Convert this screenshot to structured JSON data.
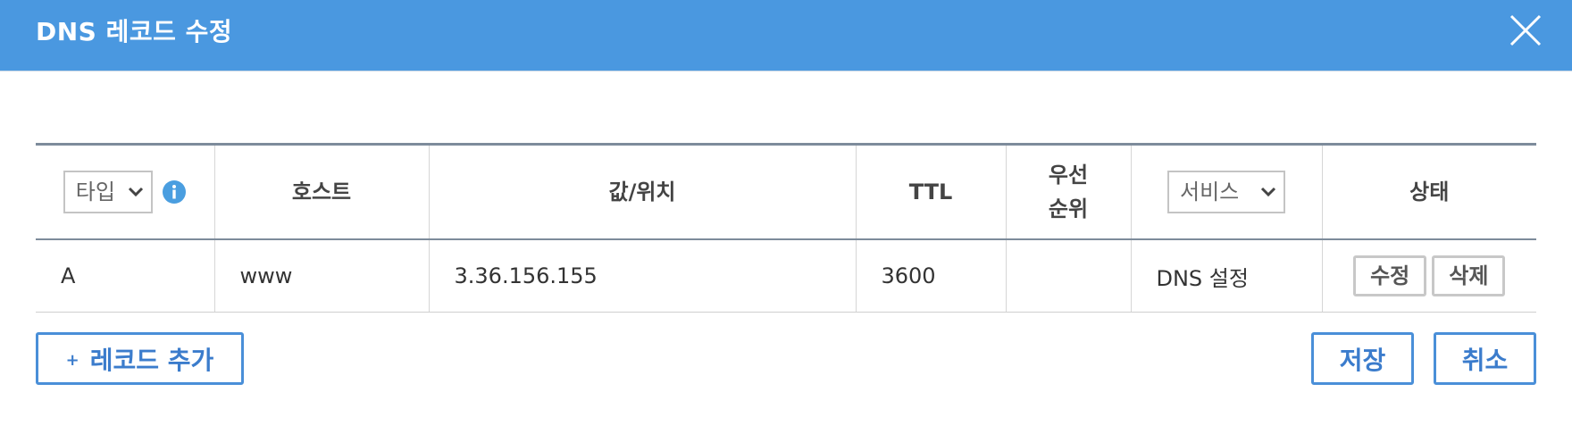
{
  "dialog": {
    "title": "DNS 레코드 수정",
    "close_icon": "close-icon"
  },
  "table": {
    "headers": {
      "type_select": "타입",
      "host": "호스트",
      "value": "값/위치",
      "ttl": "TTL",
      "priority_line1": "우선",
      "priority_line2": "순위",
      "service_select": "서비스",
      "state": "상태"
    },
    "rows": [
      {
        "type": "A",
        "host": "www",
        "value": "3.36.156.155",
        "ttl": "3600",
        "priority": "",
        "service": "DNS 설정",
        "edit_label": "수정",
        "delete_label": "삭제"
      }
    ]
  },
  "footer": {
    "add_plus": "+",
    "add_label": "레코드 추가",
    "save_label": "저장",
    "cancel_label": "취소"
  },
  "colors": {
    "header_bg": "#4a98e0",
    "accent": "#3b7ccc",
    "info_icon": "#4a9ee0",
    "table_rule": "#7d8b9b"
  }
}
